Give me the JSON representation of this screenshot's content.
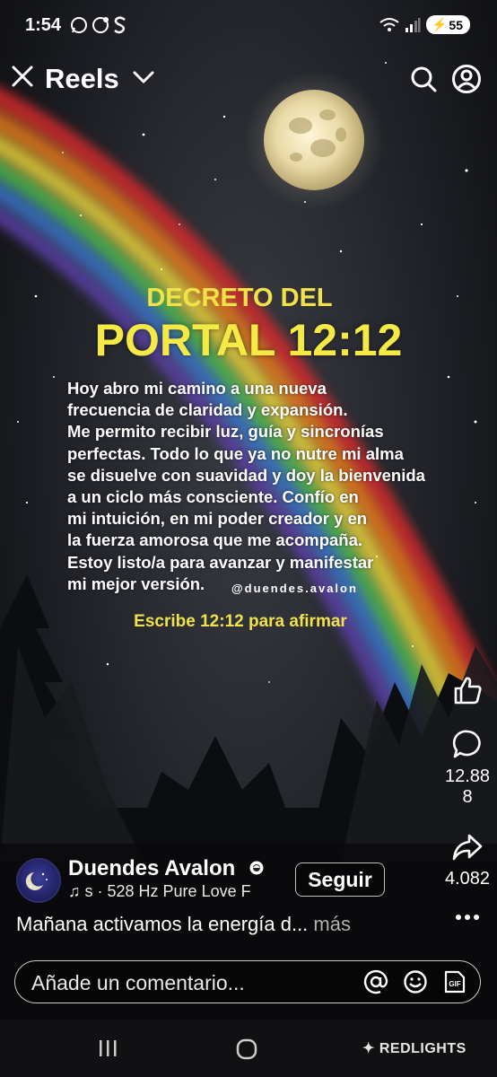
{
  "status_bar": {
    "time": "1:54",
    "battery": "55"
  },
  "header": {
    "title": "Reels"
  },
  "post": {
    "heading_line1": "DECRETO DEL",
    "heading_line2": "PORTAL 12:12",
    "body_lines": [
      "Hoy abro mi camino a una nueva",
      "frecuencia de claridad y expansión.",
      "Me permito recibir luz, guía y sincronías",
      "perfectas. Todo lo que ya no nutre mi alma",
      "se disuelve con suavidad y doy la bienvenida",
      "a un ciclo más consciente. Confío en",
      "mi intuición, en mi poder creador y en",
      "la fuerza amorosa que me acompaña.",
      "Estoy listo/a para avanzar y manifestar",
      "mi mejor versión."
    ],
    "handle": "@duendes.avalon",
    "cta": "Escribe 12:12 para afirmar"
  },
  "actions": {
    "comments_count": "12.888",
    "comments_line1": "12.88",
    "comments_line2": "8",
    "shares_count": "4.082"
  },
  "author": {
    "name": "Duendes Avalon",
    "music": "s · 528 Hz Pure Love F",
    "follow_label": "Seguir"
  },
  "caption": {
    "text": "Mañana activamos la energía d...",
    "more": "más"
  },
  "comment_box": {
    "placeholder": "Añade un comentario..."
  },
  "watermark": "REDLIGHTS",
  "colors": {
    "accent_yellow": "#f2e24a",
    "background": "#24262c"
  },
  "icons": [
    "close-icon",
    "chevron-down-icon",
    "search-icon",
    "profile-icon",
    "like-icon",
    "comment-icon",
    "share-icon",
    "more-icon",
    "music-icon",
    "verified-icon",
    "mention-icon",
    "emoji-icon",
    "gif-icon"
  ]
}
